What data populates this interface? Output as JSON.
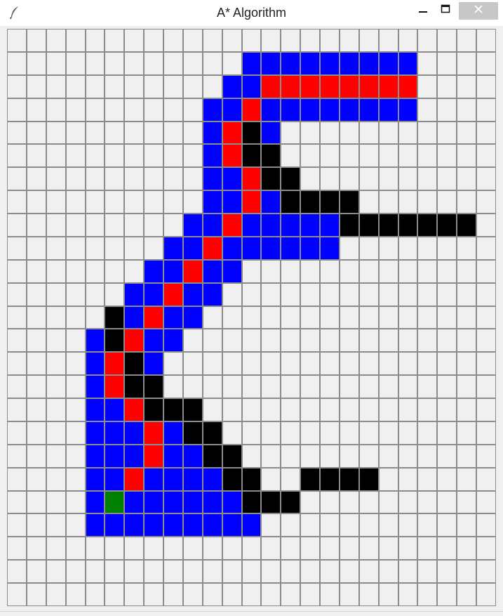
{
  "window": {
    "title": "A* Algorithm",
    "app_icon": "feather-icon",
    "controls": {
      "minimize": "minimize-icon",
      "maximize": "maximize-icon",
      "close": "close-icon"
    }
  },
  "grid": {
    "cols": 25,
    "rows": 25,
    "colors": {
      "empty": "#f0f0f0",
      "open": "#0000ff",
      "path": "#ff0000",
      "wall": "#000000",
      "start": "#008000",
      "grid_line": "#8c8c8c"
    },
    "cells": {
      "open": [
        [
          1,
          12
        ],
        [
          1,
          13
        ],
        [
          1,
          14
        ],
        [
          1,
          15
        ],
        [
          1,
          16
        ],
        [
          1,
          17
        ],
        [
          1,
          18
        ],
        [
          1,
          19
        ],
        [
          1,
          20
        ],
        [
          2,
          11
        ],
        [
          2,
          12
        ],
        [
          3,
          10
        ],
        [
          3,
          11
        ],
        [
          3,
          13
        ],
        [
          3,
          14
        ],
        [
          3,
          15
        ],
        [
          3,
          16
        ],
        [
          3,
          17
        ],
        [
          3,
          18
        ],
        [
          3,
          19
        ],
        [
          3,
          20
        ],
        [
          4,
          10
        ],
        [
          4,
          13
        ],
        [
          5,
          10
        ],
        [
          6,
          10
        ],
        [
          6,
          11
        ],
        [
          7,
          10
        ],
        [
          7,
          11
        ],
        [
          7,
          13
        ],
        [
          8,
          9
        ],
        [
          8,
          10
        ],
        [
          8,
          12
        ],
        [
          8,
          13
        ],
        [
          8,
          14
        ],
        [
          8,
          15
        ],
        [
          8,
          16
        ],
        [
          9,
          8
        ],
        [
          9,
          9
        ],
        [
          9,
          11
        ],
        [
          9,
          12
        ],
        [
          9,
          13
        ],
        [
          9,
          14
        ],
        [
          9,
          15
        ],
        [
          9,
          16
        ],
        [
          10,
          7
        ],
        [
          10,
          8
        ],
        [
          10,
          10
        ],
        [
          10,
          11
        ],
        [
          11,
          6
        ],
        [
          11,
          7
        ],
        [
          11,
          9
        ],
        [
          11,
          10
        ],
        [
          12,
          6
        ],
        [
          12,
          8
        ],
        [
          12,
          9
        ],
        [
          13,
          4
        ],
        [
          13,
          7
        ],
        [
          13,
          8
        ],
        [
          14,
          4
        ],
        [
          14,
          7
        ],
        [
          15,
          4
        ],
        [
          16,
          4
        ],
        [
          16,
          5
        ],
        [
          17,
          4
        ],
        [
          17,
          5
        ],
        [
          17,
          6
        ],
        [
          17,
          8
        ],
        [
          18,
          4
        ],
        [
          18,
          5
        ],
        [
          18,
          6
        ],
        [
          18,
          8
        ],
        [
          18,
          9
        ],
        [
          19,
          4
        ],
        [
          19,
          5
        ],
        [
          19,
          7
        ],
        [
          19,
          8
        ],
        [
          19,
          9
        ],
        [
          19,
          10
        ],
        [
          20,
          4
        ],
        [
          20,
          6
        ],
        [
          20,
          7
        ],
        [
          20,
          8
        ],
        [
          20,
          9
        ],
        [
          20,
          10
        ],
        [
          20,
          11
        ],
        [
          21,
          4
        ],
        [
          21,
          5
        ],
        [
          21,
          6
        ],
        [
          21,
          7
        ],
        [
          21,
          8
        ],
        [
          21,
          9
        ],
        [
          21,
          10
        ],
        [
          21,
          11
        ],
        [
          21,
          12
        ]
      ],
      "path": [
        [
          2,
          13
        ],
        [
          2,
          14
        ],
        [
          2,
          15
        ],
        [
          2,
          16
        ],
        [
          2,
          17
        ],
        [
          2,
          18
        ],
        [
          2,
          19
        ],
        [
          2,
          20
        ],
        [
          3,
          12
        ],
        [
          4,
          11
        ],
        [
          5,
          11
        ],
        [
          6,
          12
        ],
        [
          7,
          12
        ],
        [
          8,
          11
        ],
        [
          9,
          10
        ],
        [
          10,
          9
        ],
        [
          11,
          8
        ],
        [
          12,
          7
        ],
        [
          13,
          6
        ],
        [
          14,
          5
        ],
        [
          15,
          5
        ],
        [
          16,
          6
        ],
        [
          17,
          7
        ],
        [
          18,
          7
        ],
        [
          19,
          6
        ]
      ],
      "wall": [
        [
          4,
          12
        ],
        [
          5,
          12
        ],
        [
          5,
          13
        ],
        [
          6,
          13
        ],
        [
          6,
          14
        ],
        [
          7,
          14
        ],
        [
          7,
          15
        ],
        [
          7,
          16
        ],
        [
          7,
          17
        ],
        [
          8,
          17
        ],
        [
          8,
          18
        ],
        [
          8,
          19
        ],
        [
          8,
          20
        ],
        [
          8,
          21
        ],
        [
          8,
          22
        ],
        [
          8,
          23
        ],
        [
          12,
          5
        ],
        [
          13,
          5
        ],
        [
          14,
          6
        ],
        [
          15,
          6
        ],
        [
          15,
          7
        ],
        [
          16,
          7
        ],
        [
          16,
          8
        ],
        [
          16,
          9
        ],
        [
          17,
          9
        ],
        [
          17,
          10
        ],
        [
          18,
          10
        ],
        [
          18,
          11
        ],
        [
          19,
          11
        ],
        [
          19,
          12
        ],
        [
          19,
          15
        ],
        [
          19,
          16
        ],
        [
          19,
          17
        ],
        [
          19,
          18
        ],
        [
          20,
          12
        ],
        [
          20,
          13
        ],
        [
          20,
          14
        ]
      ],
      "start": [
        [
          20,
          5
        ]
      ]
    }
  }
}
